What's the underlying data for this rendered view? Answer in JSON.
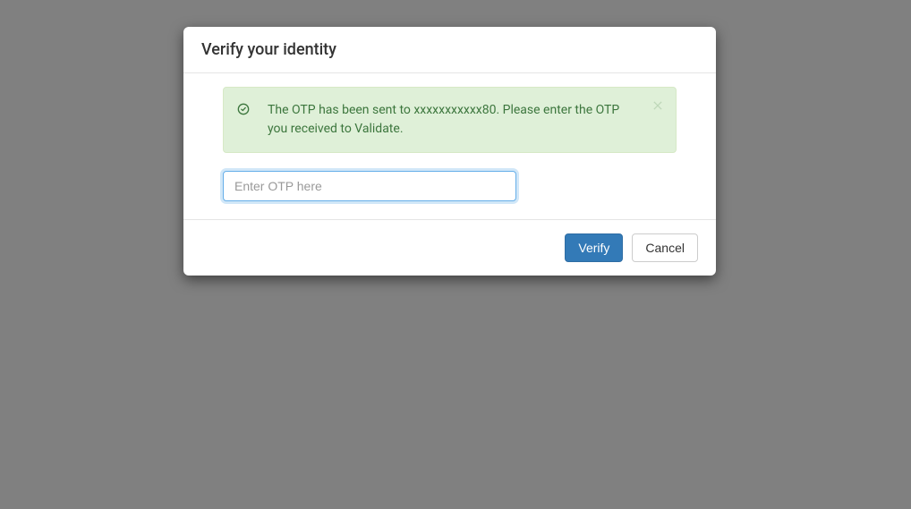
{
  "modal": {
    "title": "Verify your identity",
    "alert": {
      "message": "The OTP has been sent to xxxxxxxxxxx80. Please enter the OTP you received to Validate."
    },
    "otp": {
      "placeholder": "Enter OTP here",
      "value": ""
    },
    "footer": {
      "verify_label": "Verify",
      "cancel_label": "Cancel"
    }
  }
}
